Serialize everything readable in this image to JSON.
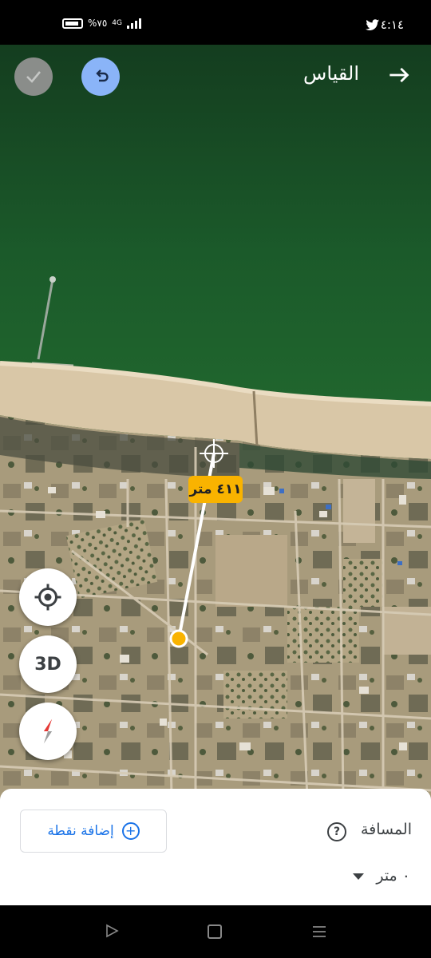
{
  "status_bar": {
    "time": "٤:١٤",
    "battery_text": "%٧٥",
    "network": "4G"
  },
  "header": {
    "title": "القياس"
  },
  "map": {
    "distance_badge": "٤١١ متر"
  },
  "controls": {
    "three_d_label": "3D"
  },
  "bottom_sheet": {
    "add_point_label": "إضافة نقطة",
    "distance_label": "المسافة",
    "distance_value": "٠ متر"
  },
  "colors": {
    "accent": "#1a73e8",
    "badge": "#f9b300",
    "undo_button": "#8ab4f8",
    "sea": "#1a4a25"
  },
  "icons": [
    "check-icon",
    "undo-icon",
    "back-arrow-icon",
    "my-location-icon",
    "compass-icon",
    "help-icon",
    "add-icon",
    "dropdown-icon",
    "twitter-icon"
  ]
}
